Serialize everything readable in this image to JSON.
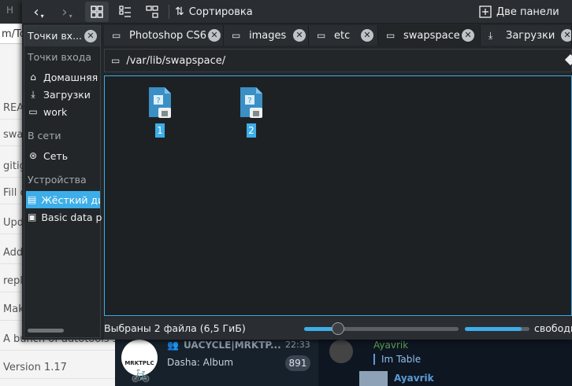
{
  "background_browser": {
    "top_text": "Н",
    "url_fragment": "m/To",
    "rows": [
      "REA",
      "swa",
      "gitig",
      "Fill c",
      "Upd",
      "Add",
      "repla",
      "Mak",
      "A bunch of autotools s",
      "Version 1.17"
    ]
  },
  "background_messenger": {
    "chat1": {
      "avatar_text": "MRKTPLC",
      "title": "UACYCLE|MRKTP...",
      "time": "22:33",
      "message": "Dasha: Album",
      "unread": "891"
    },
    "chat2": {
      "name": "Ayavrik",
      "quote": "Im Table",
      "name2": "Ayavrik"
    }
  },
  "toolbar": {
    "sort_label": "Сортировка",
    "split_label": "Две панели"
  },
  "places": {
    "title": "Точки вх...",
    "sections": {
      "entry": "Точки входа",
      "network": "В сети",
      "devices": "Устройства"
    },
    "items": {
      "home": "Домашняя",
      "downloads": "Загрузки",
      "work": "work",
      "network": "Сеть",
      "hdd": "Жёсткий ди",
      "basic": "Basic data p"
    }
  },
  "tabs": [
    "Photoshop CS6",
    "images",
    "etc",
    "swapspace",
    "Загрузки"
  ],
  "location": {
    "path": "/var/lib/swapspace/"
  },
  "files": [
    "1",
    "2"
  ],
  "status": {
    "selection": "Выбраны 2 файла (6,5 ГиБ)",
    "zoom_fraction": 0.22,
    "free_fraction": 0.88,
    "free_text": "свободно"
  },
  "colors": {
    "accent": "#3daee9",
    "window_bg": "#232629",
    "messenger_bg": "#17212b"
  }
}
